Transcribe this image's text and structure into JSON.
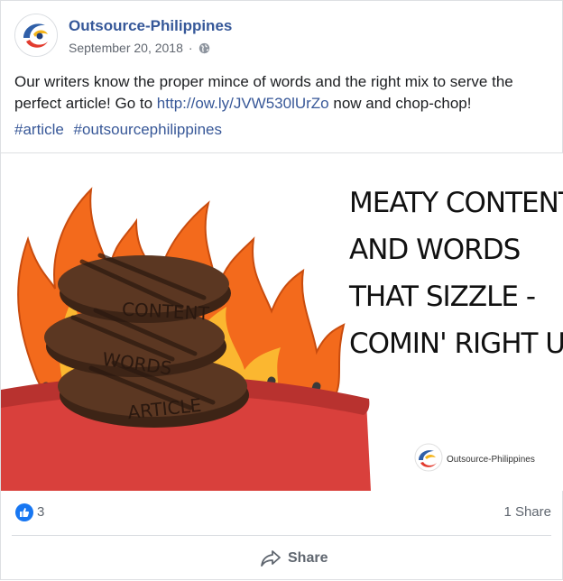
{
  "post": {
    "page_name": "Outsource-Philippines",
    "date": "September 20, 2018",
    "separator": "·",
    "text_before_link": "Our writers know the proper mince of words and the right mix to serve the perfect article! Go to ",
    "link": "http://ow.ly/JVW530lUrZo",
    "text_after_link": " now and chop-chop!",
    "hashtags": [
      "#article",
      "#outsourcephilippines"
    ]
  },
  "image": {
    "headline_lines": [
      "MEATY CONTENT",
      "AND WORDS",
      "THAT SIZZLE -",
      "COMIN' RIGHT UP!"
    ],
    "patty_labels": [
      "CONTENT",
      "WORDS",
      "ARTICLE"
    ],
    "brand_logo_text": "Outsource-Philippines",
    "colors": {
      "flame_outer": "#f36a1c",
      "flame_inner": "#fbb730",
      "grill": "#d9403c",
      "grill_dark": "#b8322f",
      "patty": "#5b3722",
      "patty_dark": "#3d2416"
    }
  },
  "stats": {
    "like_count": "3",
    "share_count": "1 Share"
  },
  "actions": {
    "share_label": "Share"
  },
  "icons": {
    "avatar": "outsource-philippines-logo",
    "audience": "globe-icon",
    "like": "like-icon",
    "share": "share-arrow-icon"
  }
}
